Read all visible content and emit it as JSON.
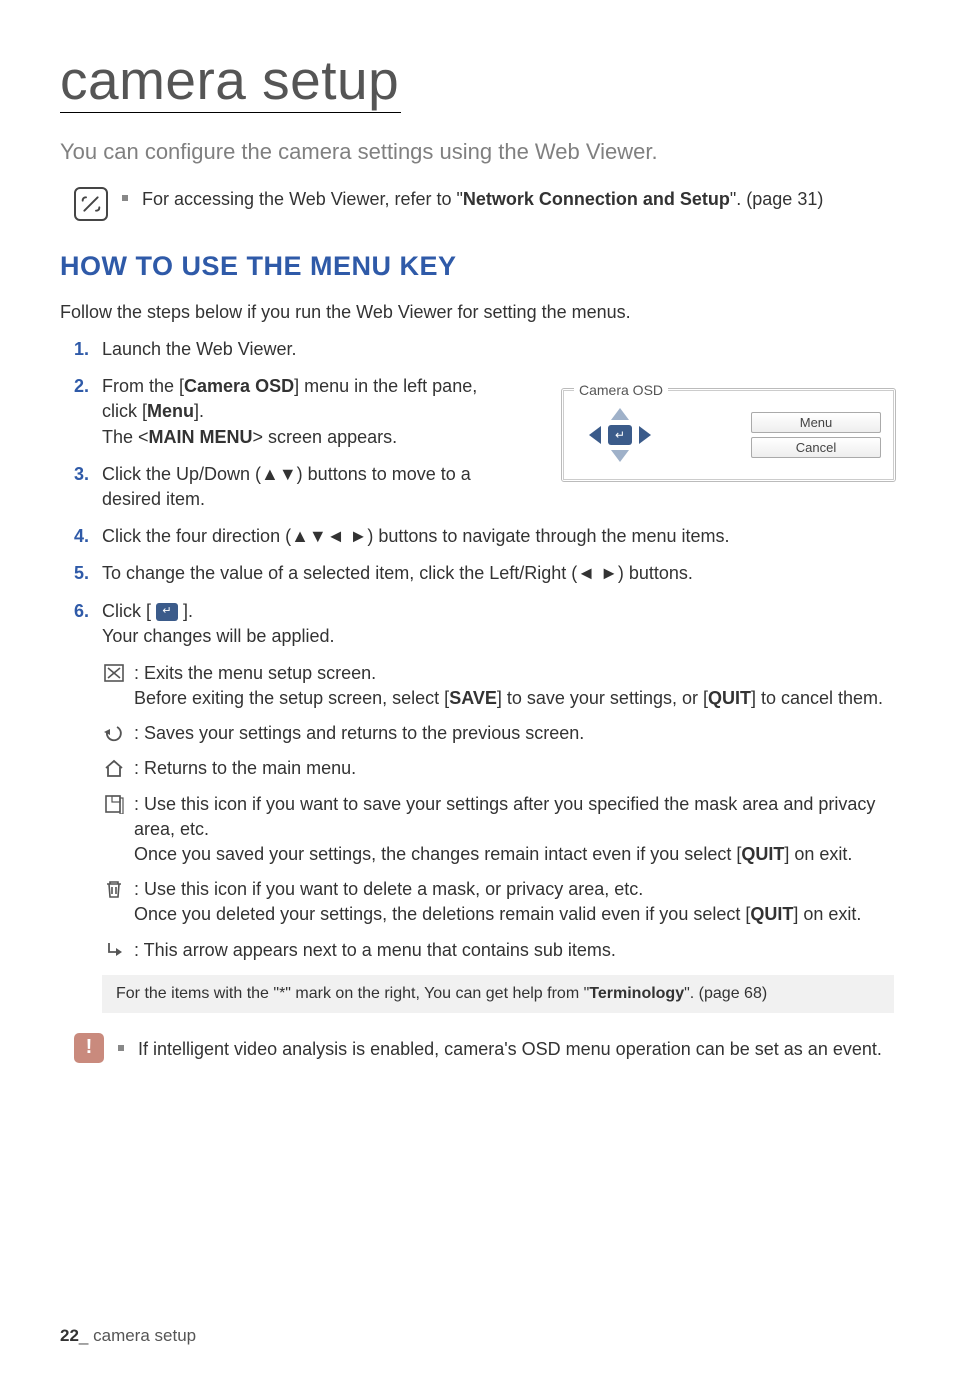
{
  "title": "camera setup",
  "intro": "You can configure the camera settings using the Web Viewer.",
  "note1_pre": "For accessing the Web Viewer, refer to \"",
  "note1_bold": "Network Connection and Setup",
  "note1_post": "\". (page 31)",
  "section_head": "HOW TO USE THE MENU KEY",
  "body1": "Follow the steps below if you run the Web Viewer for setting the menus.",
  "steps": {
    "s1": "Launch the Web Viewer.",
    "s2_a": "From the [",
    "s2_b": "Camera OSD",
    "s2_c": "] menu in the left pane, click [",
    "s2_d": "Menu",
    "s2_e": "].",
    "s2_sub_a": "The <",
    "s2_sub_b": "MAIN MENU",
    "s2_sub_c": "> screen appears.",
    "s3": "Click the Up/Down (▲▼) buttons to move to a desired item.",
    "s4": "Click the four direction (▲▼◄ ►) buttons to navigate through the menu items.",
    "s5": "To change the value of a selected item, click the Left/Right (◄ ►) buttons.",
    "s6_a": "Click [ ",
    "s6_b": " ].",
    "s6_sub": "Your changes will be applied."
  },
  "figure": {
    "legend": "Camera OSD",
    "menu_btn": "Menu",
    "cancel_btn": "Cancel"
  },
  "glyphs": {
    "exit_a": ": Exits the menu setup screen.",
    "exit_b_a": "Before exiting the setup screen, select [",
    "exit_b_b": "SAVE",
    "exit_b_c": "] to save your settings, or [",
    "exit_b_d": "QUIT",
    "exit_b_e": "] to cancel them.",
    "back": ": Saves your settings and returns to the previous screen.",
    "home": ": Returns to the main menu.",
    "save_a": ": Use this icon if you want to save your settings after you specified the mask area and privacy area, etc.",
    "save_b_a": "Once you saved your settings, the changes remain intact even if you select [",
    "save_b_b": "QUIT",
    "save_b_c": "] on exit.",
    "del_a": ": Use this icon if you want to delete a mask, or privacy area, etc.",
    "del_b_a": "Once you deleted your settings, the deletions remain valid even if you select [",
    "del_b_b": "QUIT",
    "del_b_c": "] on exit.",
    "sub": ": This arrow appears next to a menu that contains sub items."
  },
  "tip_a": "For the items with the \"*\" mark on the right, You can get help from \"",
  "tip_b": "Terminology",
  "tip_c": "\". (page 68)",
  "caution": "If intelligent video analysis is enabled, camera's OSD menu operation can be set as an event.",
  "footer_num": "22",
  "footer_sep": "_ ",
  "footer_text": "camera setup"
}
